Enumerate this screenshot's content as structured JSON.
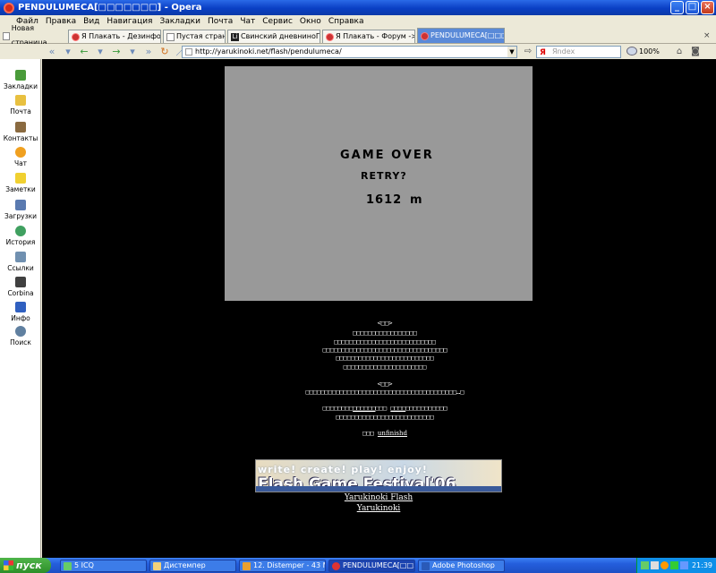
{
  "window": {
    "title": "PENDULUMECA[□□□□□□□] - Opera"
  },
  "menu": [
    "Файл",
    "Правка",
    "Вид",
    "Навигация",
    "Закладки",
    "Почта",
    "Чат",
    "Сервис",
    "Окно",
    "Справка"
  ],
  "tabs": {
    "new_tab": "Новая страница",
    "items": [
      {
        "label": "Я Плакать - Дезинформа…",
        "icon": "opera-icon"
      },
      {
        "label": "Пустая страница",
        "icon": "page-icon"
      },
      {
        "label": "Свинский дневниноГ : Li…",
        "icon": "li-icon"
      },
      {
        "label": "Я Плакать - Форум -> иг…",
        "icon": "opera-icon"
      },
      {
        "label": "PENDULUMECA[□□□□□…",
        "icon": "opera-icon",
        "active": true
      }
    ]
  },
  "address": {
    "url": "http://yarukinoki.net/flash/pendulumeca/",
    "search_placeholder": "Яndex",
    "zoom": "100%"
  },
  "sidebar": [
    {
      "label": "Закладки",
      "icon": "bookmarks-icon",
      "color": "#4a9b3a"
    },
    {
      "label": "Почта",
      "icon": "mail-icon",
      "color": "#e8c040"
    },
    {
      "label": "Контакты",
      "icon": "contacts-icon",
      "color": "#8a6a40"
    },
    {
      "label": "Чат",
      "icon": "chat-icon",
      "color": "#f0a020"
    },
    {
      "label": "Заметки",
      "icon": "notes-icon",
      "color": "#f0d030"
    },
    {
      "label": "Загрузки",
      "icon": "downloads-icon",
      "color": "#5a7ab0"
    },
    {
      "label": "История",
      "icon": "history-icon",
      "color": "#40a060"
    },
    {
      "label": "Ссылки",
      "icon": "links-icon",
      "color": "#7090b0"
    },
    {
      "label": "Corbina",
      "icon": "corbina-icon",
      "color": "#404040"
    },
    {
      "label": "Инфо",
      "icon": "info-icon",
      "color": "#3060c0"
    },
    {
      "label": "Поиск",
      "icon": "search-icon",
      "color": "#6080a0"
    }
  ],
  "game": {
    "title": "GAME OVER",
    "retry": "RETRY?",
    "distance": "1612",
    "unit": "m"
  },
  "page": {
    "jp1_head": "<□□>",
    "jp1_l1": "□□□□□□□□□□□□□□□□□",
    "jp1_l2": "□□□□□□□□□□□□□□□□□□□□□□□□□□□",
    "jp1_l3": "□□□□□□□□□□□□□□□□□□□□□□□□□□□□□□□□□",
    "jp1_l4": "□□□□□□□□□□□□□□□□□□□□□□□□□□",
    "jp1_l5": "□□□□□□□□□□□□□□□□□□□□□□",
    "jp2_head": "<□□>",
    "jp2_l1": "□□□□□□□□□□□□□□□□□□□□□□□□□□□□□□□□□□□□□□□□…□",
    "jp3_a": "□□□□□□□□",
    "jp3_link1": "□□□□□□",
    "jp3_b": "□□□",
    "jp3_link2": "□□□□",
    "jp3_c": "□□□□□□□□□□□",
    "jp3_l2": "□□□□□□□□□□□□□□□□□□□□□□□□□□",
    "jp4_prefix": "□□□",
    "jp4_link": "unfinishd",
    "banner_top": "write! create! play! enjoy!",
    "banner_main": "Flash Game Festival'06",
    "link1": "Yarukinoki Flash",
    "link2": "Yarukinoki"
  },
  "taskbar": {
    "start": "пуск",
    "items": [
      {
        "label": "5 ICQ",
        "icon": "icq-icon"
      },
      {
        "label": "Дистемпер",
        "icon": "folder-icon"
      },
      {
        "label": "12. Distemper - 43 M…",
        "icon": "player-icon"
      },
      {
        "label": "PENDULUMECA[□□…",
        "icon": "opera-icon",
        "active": true
      },
      {
        "label": "Adobe Photoshop",
        "icon": "photoshop-icon"
      }
    ],
    "clock": "21:39"
  }
}
